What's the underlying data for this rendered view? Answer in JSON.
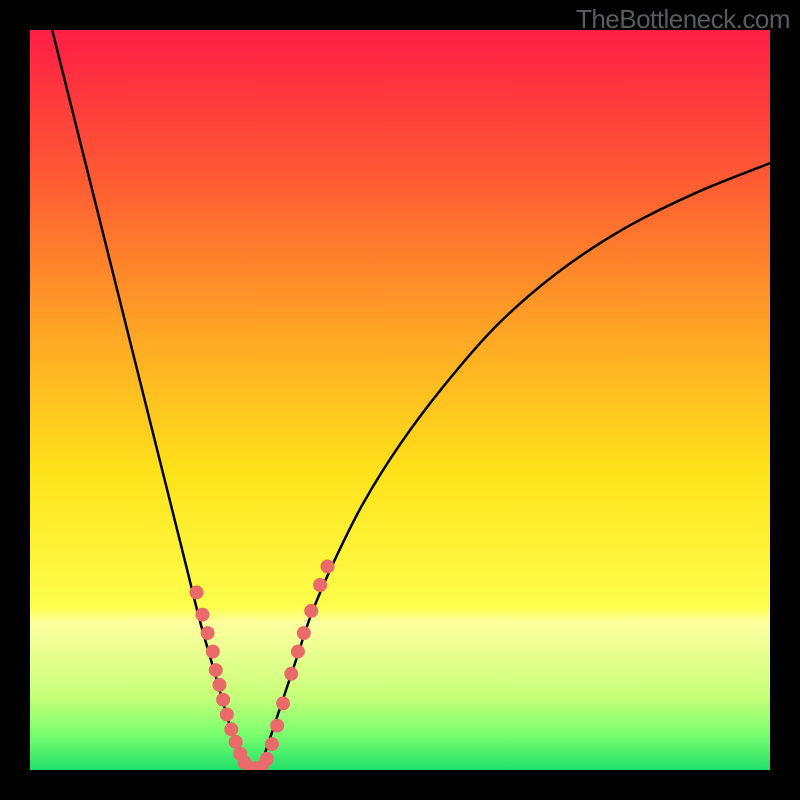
{
  "watermark": "TheBottleneck.com",
  "chart_data": {
    "type": "line",
    "title": "",
    "xlabel": "",
    "ylabel": "",
    "xlim": [
      0,
      100
    ],
    "ylim": [
      0,
      100
    ],
    "grid": false,
    "legend": false,
    "gradient_stops": [
      {
        "offset": 0.0,
        "color": "#ff1e46"
      },
      {
        "offset": 0.2,
        "color": "#ff5a33"
      },
      {
        "offset": 0.4,
        "color": "#ffa225"
      },
      {
        "offset": 0.6,
        "color": "#ffe31a"
      },
      {
        "offset": 0.78,
        "color": "#fdff4d"
      },
      {
        "offset": 0.8,
        "color": "#ffff9e"
      },
      {
        "offset": 0.9,
        "color": "#c8ff7a"
      },
      {
        "offset": 0.95,
        "color": "#7dff6e"
      },
      {
        "offset": 1.0,
        "color": "#22e06a"
      }
    ],
    "series": [
      {
        "name": "left-curve",
        "color": "#000000",
        "x": [
          3,
          5,
          7,
          9,
          11,
          13,
          15,
          17,
          19,
          21,
          23,
          25,
          27,
          28.5,
          29.5
        ],
        "y": [
          100,
          92,
          84,
          76,
          68,
          60,
          52,
          44,
          36,
          28,
          20,
          13,
          6,
          2,
          0
        ]
      },
      {
        "name": "right-curve",
        "color": "#000000",
        "x": [
          31,
          32,
          34,
          36,
          38,
          41,
          45,
          50,
          56,
          63,
          71,
          80,
          90,
          100
        ],
        "y": [
          0,
          3,
          9,
          15,
          21,
          28,
          36,
          44,
          52,
          60,
          67,
          73,
          78,
          82
        ]
      }
    ],
    "scatter": {
      "name": "markers",
      "color": "#ea6a6a",
      "radius": 7,
      "points": [
        {
          "x": 22.5,
          "y": 24
        },
        {
          "x": 23.3,
          "y": 21
        },
        {
          "x": 24.0,
          "y": 18.5
        },
        {
          "x": 24.7,
          "y": 16
        },
        {
          "x": 25.1,
          "y": 13.5
        },
        {
          "x": 25.6,
          "y": 11.5
        },
        {
          "x": 26.1,
          "y": 9.5
        },
        {
          "x": 26.6,
          "y": 7.5
        },
        {
          "x": 27.2,
          "y": 5.5
        },
        {
          "x": 27.8,
          "y": 3.8
        },
        {
          "x": 28.4,
          "y": 2.2
        },
        {
          "x": 29.0,
          "y": 1.0
        },
        {
          "x": 29.7,
          "y": 0.3
        },
        {
          "x": 30.5,
          "y": 0.2
        },
        {
          "x": 31.3,
          "y": 0.4
        },
        {
          "x": 32.0,
          "y": 1.5
        },
        {
          "x": 32.7,
          "y": 3.5
        },
        {
          "x": 33.4,
          "y": 6.0
        },
        {
          "x": 34.2,
          "y": 9.0
        },
        {
          "x": 35.3,
          "y": 13.0
        },
        {
          "x": 36.2,
          "y": 16.0
        },
        {
          "x": 37.0,
          "y": 18.5
        },
        {
          "x": 38.0,
          "y": 21.5
        },
        {
          "x": 39.2,
          "y": 25.0
        },
        {
          "x": 40.2,
          "y": 27.5
        }
      ]
    }
  }
}
